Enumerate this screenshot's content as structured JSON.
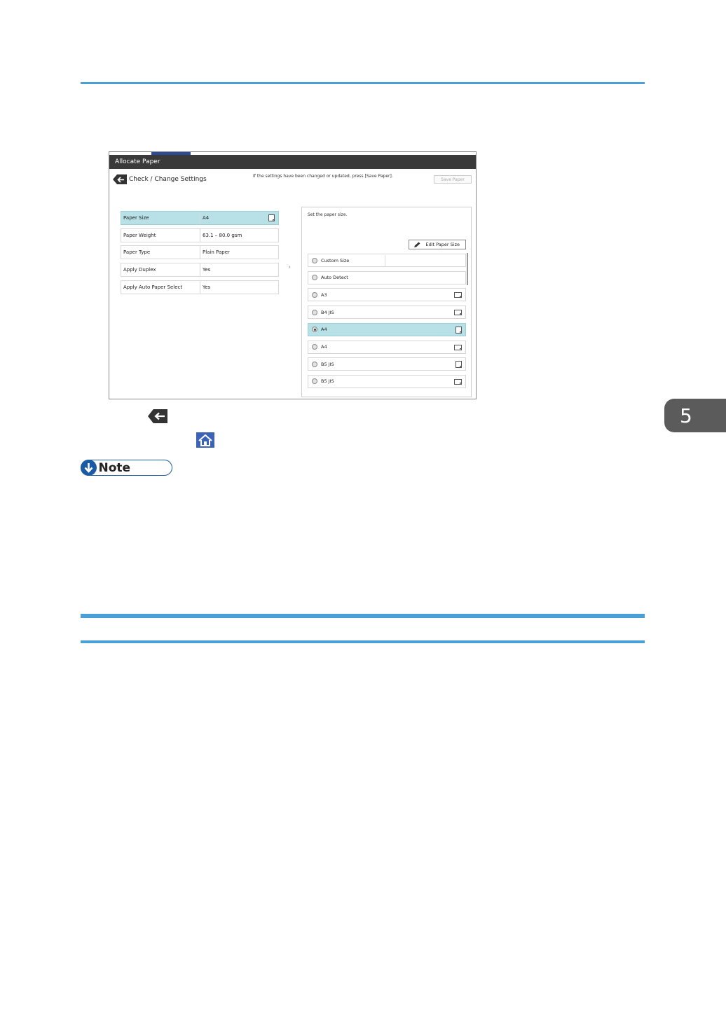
{
  "chapter_tab": "5",
  "screenshot": {
    "title": "Allocate Paper",
    "back_label": "Check / Change Settings",
    "hint": "If the settings have been changed or updated, press [Save Paper].",
    "save_button": "Save Paper",
    "settings": [
      {
        "label": "Paper Size",
        "value": "A4",
        "selected": true
      },
      {
        "label": "Paper Weight",
        "value": "63.1 – 80.0 gsm"
      },
      {
        "label": "Paper Type",
        "value": "Plain Paper"
      },
      {
        "label": "Apply Duplex",
        "value": "Yes"
      },
      {
        "label": "Apply Auto Paper Select",
        "value": "Yes"
      }
    ],
    "panel_title": "Set the paper size.",
    "edit_button": "Edit Paper Size",
    "options": [
      {
        "label": "Custom Size"
      },
      {
        "label": "Auto Detect"
      },
      {
        "label": "A3",
        "icon": "landscape-paper-icon"
      },
      {
        "label": "B4 JIS",
        "icon": "landscape-paper-icon"
      },
      {
        "label": "A4",
        "icon": "portrait-paper-icon",
        "selected": true
      },
      {
        "label": "A4",
        "icon": "landscape-paper-icon"
      },
      {
        "label": "B5 JIS",
        "icon": "portrait-paper-icon"
      },
      {
        "label": "B5 JIS",
        "icon": "landscape-paper-icon"
      }
    ]
  },
  "note_label": "Note",
  "colors": {
    "accent_rule": "#4a9fd6",
    "selected_row": "#b7e1e6",
    "note_blue": "#1a5ba6",
    "home_blue": "#3d63b8",
    "chapter_tab": "#5b5b5b"
  }
}
